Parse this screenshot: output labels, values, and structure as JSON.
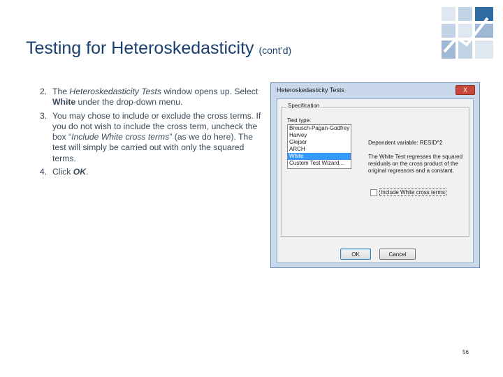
{
  "slide": {
    "title_main": "Testing for Heteroskedasticity",
    "title_suffix": "(cont’d)",
    "page_number": "56"
  },
  "bullets": [
    {
      "num": "2.",
      "parts": [
        "The ",
        "Heteroskedasticity Tests",
        " window opens up. Select ",
        "White",
        " under the drop-down menu."
      ]
    },
    {
      "num": "3.",
      "parts": [
        "You may chose to include or exclude the cross terms. If you do not wish to include the cross term, uncheck the box “",
        "Include White cross terms",
        "” (as we do here). The test will simply be carried out with only the squared terms."
      ]
    },
    {
      "num": "4.",
      "parts": [
        "Click ",
        "OK",
        "."
      ]
    }
  ],
  "dialog": {
    "title": "Heteroskedasticity Tests",
    "close_label": "X",
    "group_label": "Specification",
    "test_type_label": "Test type:",
    "test_types": [
      "Breusch-Pagan-Godfrey",
      "Harvey",
      "Glejser",
      "ARCH",
      "White",
      "Custom Test Wizard..."
    ],
    "selected_test": "White",
    "dependent_variable": "Dependent variable: RESID^2",
    "test_description": "The White Test regresses the squared residuals on the cross product of the original regressors and a constant.",
    "checkbox_label": "Include White cross terms",
    "checkbox_checked": false,
    "ok_label": "OK",
    "cancel_label": "Cancel"
  },
  "colors": {
    "title": "#1a3f6e",
    "body_text": "#3b4a5a",
    "selection": "#3399ff",
    "dialog_frame": "#c9d8ea"
  }
}
